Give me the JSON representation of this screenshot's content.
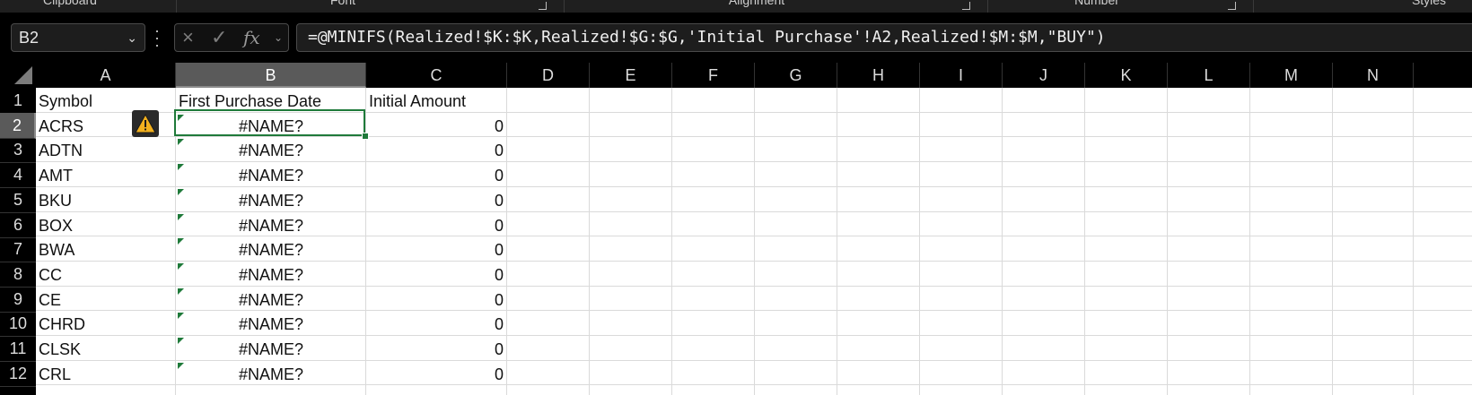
{
  "ribbon": {
    "groups": [
      {
        "label": "Clipboard"
      },
      {
        "label": "Font"
      },
      {
        "label": "Alignment"
      },
      {
        "label": "Number"
      },
      {
        "label": "Styles"
      }
    ]
  },
  "name_box": {
    "value": "B2"
  },
  "formula_bar": {
    "cancel_icon": "×",
    "enter_icon": "✓",
    "fx_label": "fx",
    "formula": "=@MINIFS(Realized!$K:$K,Realized!$G:$G,'Initial Purchase'!A2,Realized!$M:$M,\"BUY\")"
  },
  "columns": [
    "A",
    "B",
    "C",
    "D",
    "E",
    "F",
    "G",
    "H",
    "I",
    "J",
    "K",
    "L",
    "M",
    "N"
  ],
  "selected_column": "B",
  "selected_row": "2",
  "rows": [
    {
      "num": "1",
      "a": "Symbol",
      "b": "First Purchase Date",
      "c": "Initial Amount"
    },
    {
      "num": "2",
      "a": "ACRS",
      "b": "#NAME?",
      "c": "0"
    },
    {
      "num": "3",
      "a": "ADTN",
      "b": "#NAME?",
      "c": "0"
    },
    {
      "num": "4",
      "a": "AMT",
      "b": "#NAME?",
      "c": "0"
    },
    {
      "num": "5",
      "a": "BKU",
      "b": "#NAME?",
      "c": "0"
    },
    {
      "num": "6",
      "a": "BOX",
      "b": "#NAME?",
      "c": "0"
    },
    {
      "num": "7",
      "a": "BWA",
      "b": "#NAME?",
      "c": "0"
    },
    {
      "num": "8",
      "a": "CC",
      "b": "#NAME?",
      "c": "0"
    },
    {
      "num": "9",
      "a": "CE",
      "b": "#NAME?",
      "c": "0"
    },
    {
      "num": "10",
      "a": "CHRD",
      "b": "#NAME?",
      "c": "0"
    },
    {
      "num": "11",
      "a": "CLSK",
      "b": "#NAME?",
      "c": "0"
    },
    {
      "num": "12",
      "a": "CRL",
      "b": "#NAME?",
      "c": "0"
    }
  ],
  "icons": {
    "warning": "warning-icon",
    "dropdown": "chevron-down-icon"
  },
  "colors": {
    "accent_green": "#1f7a3a",
    "header_bg": "#000000",
    "warning_yellow": "#f2b01e"
  }
}
